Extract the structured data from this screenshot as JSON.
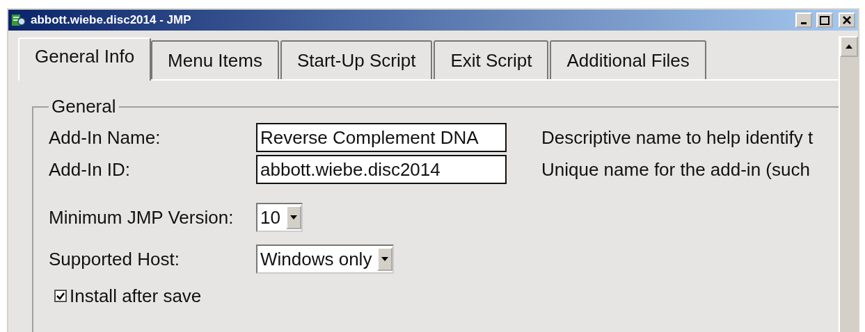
{
  "window": {
    "title": "abbott.wiebe.disc2014 - JMP"
  },
  "tabs": [
    {
      "label": "General Info",
      "selected": true
    },
    {
      "label": "Menu Items",
      "selected": false
    },
    {
      "label": "Start-Up Script",
      "selected": false
    },
    {
      "label": "Exit Script",
      "selected": false
    },
    {
      "label": "Additional Files",
      "selected": false
    }
  ],
  "group": {
    "title": "General",
    "fields": [
      {
        "label": "Add-In Name:",
        "value": "Reverse Complement DNA",
        "hint": "Descriptive name to help identify t"
      },
      {
        "label": "Add-In ID:",
        "value": "abbott.wiebe.disc2014",
        "hint": "Unique name for the add-in (such"
      }
    ],
    "dropdowns": [
      {
        "label": "Minimum JMP Version:",
        "value": "10"
      },
      {
        "label": "Supported Host:",
        "value": "Windows only"
      }
    ],
    "checkbox": {
      "label": "Install after save",
      "checked": true
    }
  }
}
